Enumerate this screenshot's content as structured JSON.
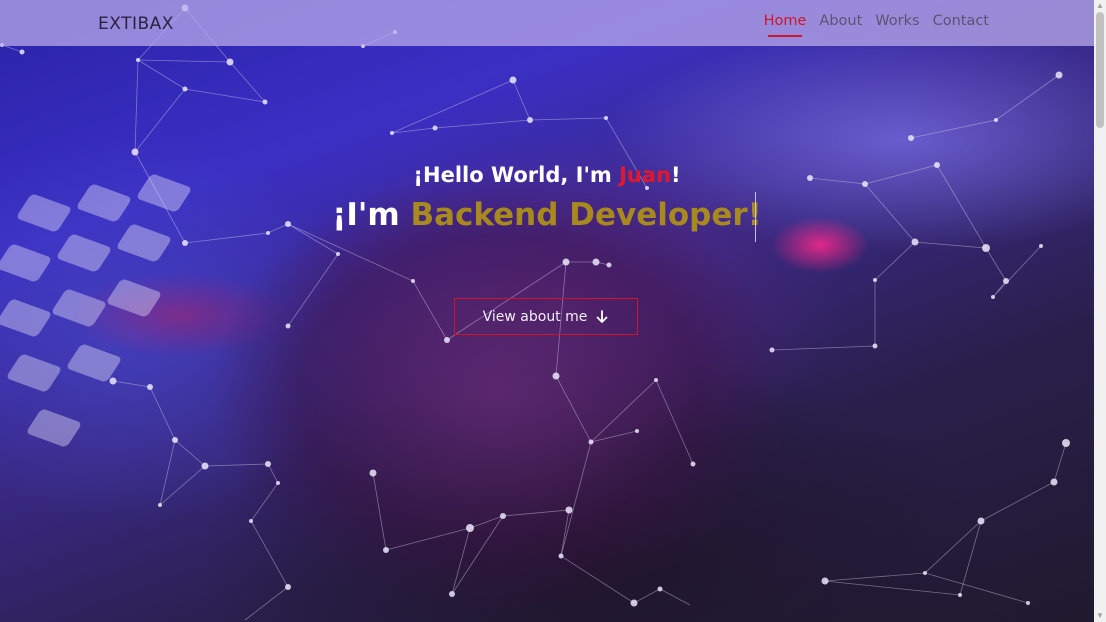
{
  "brand": "EXTIBAX",
  "nav": {
    "items": [
      "Home",
      "About",
      "Works",
      "Contact"
    ],
    "active": "Home",
    "active_color": "#d01528"
  },
  "hero": {
    "greeting_pre": "¡Hello World, I'm ",
    "greeting_name": "Juan",
    "greeting_post": "!",
    "role_pre": "¡I'm ",
    "role_job": "Backend Developer!",
    "cta_label": "View about me",
    "cta_icon": "arrow-down-icon",
    "name_color": "#e0182b",
    "role_color": "#a8891e",
    "background": "keyboard-hand-photo with particle network overlay"
  }
}
